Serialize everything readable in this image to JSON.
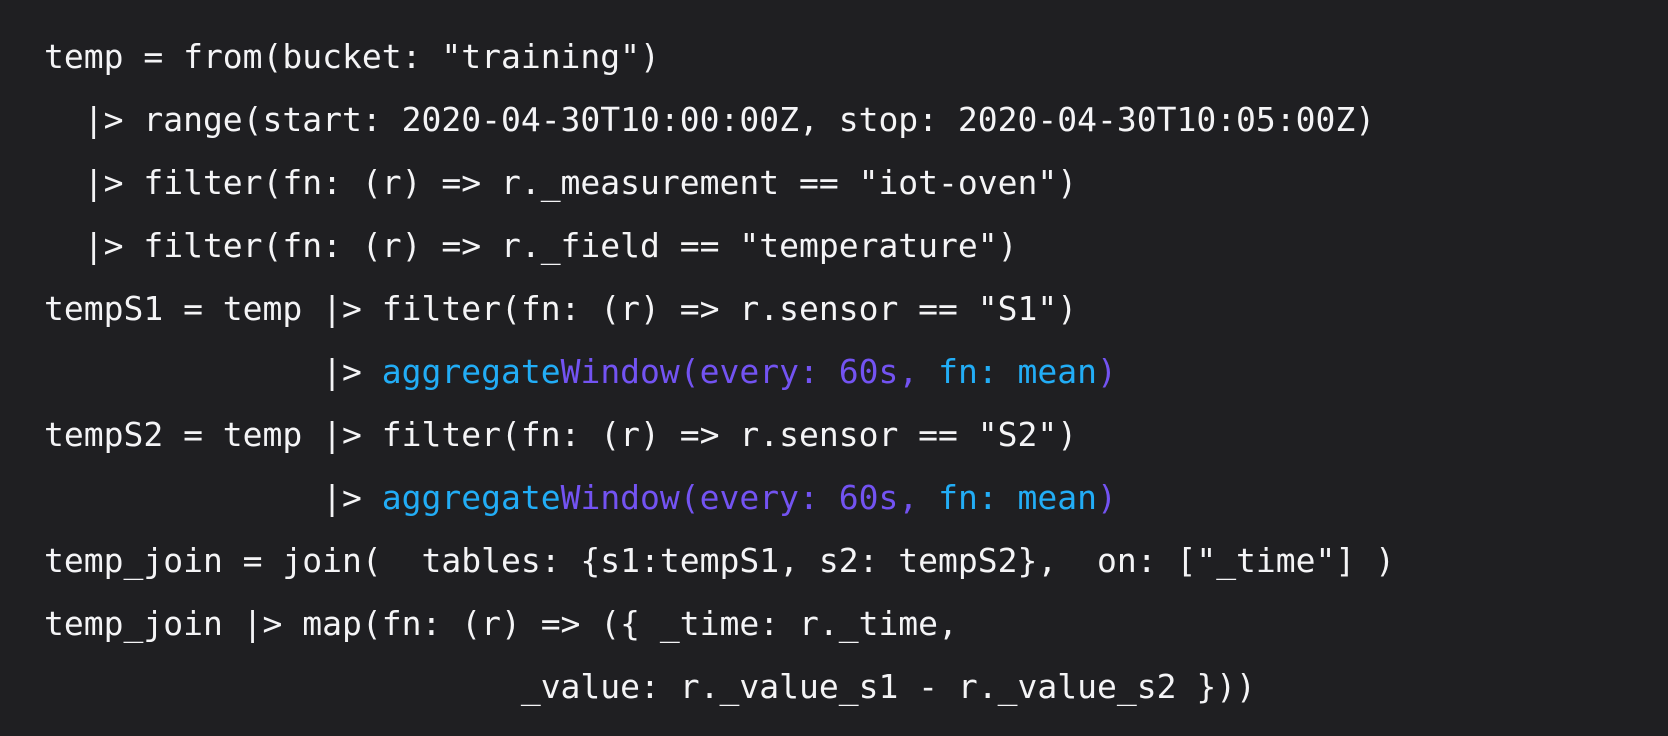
{
  "colors": {
    "background": "#1f1f22",
    "text": "#f4f4f6",
    "function_highlight": "#22adf6",
    "param_highlight": "#7353f2"
  },
  "code": {
    "lines": [
      {
        "segments": [
          {
            "text": "temp = from(bucket: \"training\")",
            "color": "plain"
          }
        ]
      },
      {
        "segments": [
          {
            "text": "  |> range(start: 2020-04-30T10:00:00Z, stop: 2020-04-30T10:05:00Z)",
            "color": "plain"
          }
        ]
      },
      {
        "segments": [
          {
            "text": "  |> filter(fn: (r) => r._measurement == \"iot-oven\")",
            "color": "plain"
          }
        ]
      },
      {
        "segments": [
          {
            "text": "  |> filter(fn: (r) => r._field == \"temperature\")",
            "color": "plain"
          }
        ]
      },
      {
        "segments": [
          {
            "text": "tempS1 = temp |> filter(fn: (r) => r.sensor == \"S1\")",
            "color": "plain"
          }
        ]
      },
      {
        "segments": [
          {
            "text": "              |> ",
            "color": "plain"
          },
          {
            "text": "aggregate",
            "color": "cyan"
          },
          {
            "text": "Window(every: 60s, ",
            "color": "purple"
          },
          {
            "text": "fn: mean",
            "color": "cyan"
          },
          {
            "text": ")",
            "color": "purple"
          }
        ]
      },
      {
        "segments": [
          {
            "text": "tempS2 = temp |> filter(fn: (r) => r.sensor == \"S2\")",
            "color": "plain"
          }
        ]
      },
      {
        "segments": [
          {
            "text": "              |> ",
            "color": "plain"
          },
          {
            "text": "aggregate",
            "color": "cyan"
          },
          {
            "text": "Window(every: 60s, ",
            "color": "purple"
          },
          {
            "text": "fn: mean",
            "color": "cyan"
          },
          {
            "text": ")",
            "color": "purple"
          }
        ]
      },
      {
        "segments": [
          {
            "text": "temp_join = join(  tables: {s1:tempS1, s2: tempS2},  on: [\"_time\"] )",
            "color": "plain"
          }
        ]
      },
      {
        "segments": [
          {
            "text": "temp_join |> map(fn: (r) => ({ _time: r._time,",
            "color": "plain"
          }
        ]
      },
      {
        "segments": [
          {
            "text": "                        _value: r._value_s1 - r._value_s2 }))",
            "color": "plain"
          }
        ]
      }
    ]
  }
}
